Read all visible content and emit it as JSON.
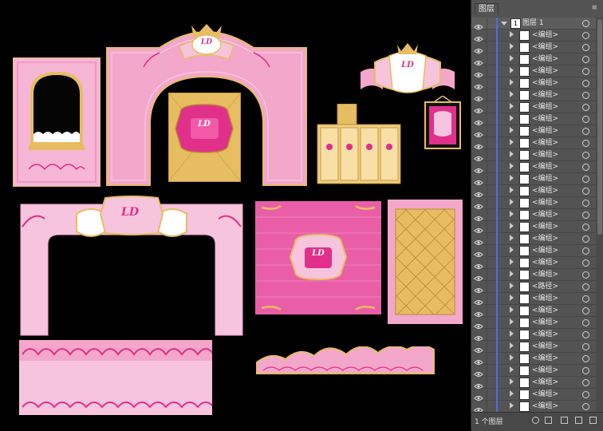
{
  "panel": {
    "tab_label": "图层",
    "menu_icon": "panel-menu-icon",
    "parent_layer": {
      "name": "图层 1",
      "number": "1"
    },
    "sublayers": [
      "<编组>",
      "<编组>",
      "<编组>",
      "<编组>",
      "<编组>",
      "<编组>",
      "<编组>",
      "<编组>",
      "<编组>",
      "<编组>",
      "<编组>",
      "<编组>",
      "<编组>",
      "<编组>",
      "<编组>",
      "<编组>",
      "<编组>",
      "<编组>",
      "<编组>",
      "<编组>",
      "<编组>",
      "<路径>",
      "<编组>",
      "<编组>",
      "<编组>",
      "<编组>",
      "<编组>",
      "<编组>",
      "<编组>",
      "<编组>",
      "<编组>",
      "<编组>"
    ],
    "footer_count": "1 个图层",
    "footer_icons": [
      "locate-object-icon",
      "make-clipping-mask-icon",
      "new-sublayer-icon",
      "new-layer-icon",
      "delete-layer-icon"
    ]
  },
  "canvas": {
    "monogram": "LD",
    "colors": {
      "pink_light": "#f7c4dd",
      "pink_mid": "#ef8fbf",
      "magenta": "#e0308a",
      "gold": "#e7bd62",
      "gold_dark": "#b98b2c",
      "background": "#000000"
    }
  }
}
